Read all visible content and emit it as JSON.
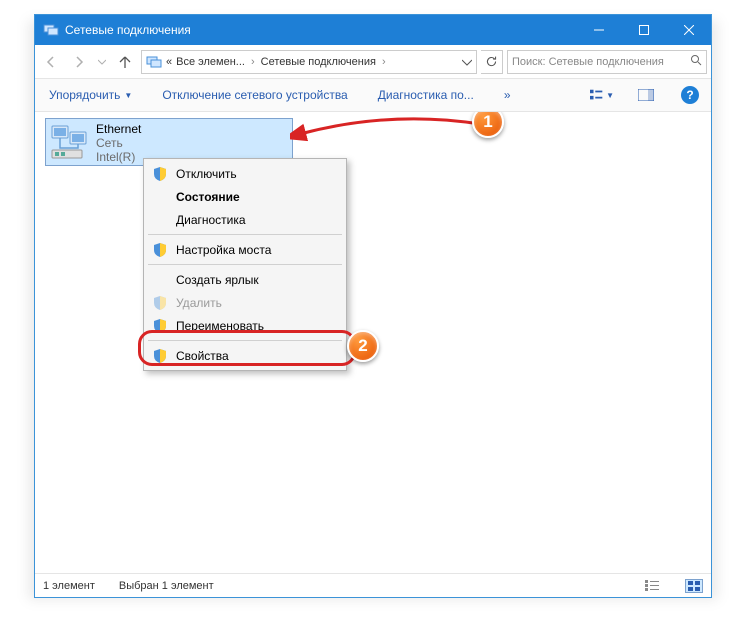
{
  "window": {
    "title": "Сетевые подключения"
  },
  "breadcrumbs": {
    "prefix": "«",
    "item1": "Все элемен...",
    "item2": "Сетевые подключения"
  },
  "search": {
    "placeholder": "Поиск: Сетевые подключения"
  },
  "commands": {
    "organize": "Упорядочить",
    "disable": "Отключение сетевого устройства",
    "diagnose": "Диагностика по...",
    "more": "»"
  },
  "adapter": {
    "name": "Ethernet",
    "network": "Сеть",
    "device": "Intel(R)"
  },
  "context_menu": {
    "disable": "Отключить",
    "status": "Состояние",
    "diagnostics": "Диагностика",
    "bridge": "Настройка моста",
    "shortcut": "Создать ярлык",
    "delete": "Удалить",
    "rename": "Переименовать",
    "properties": "Свойства"
  },
  "status": {
    "count": "1 элемент",
    "selected": "Выбран 1 элемент"
  },
  "callouts": {
    "one": "1",
    "two": "2"
  }
}
